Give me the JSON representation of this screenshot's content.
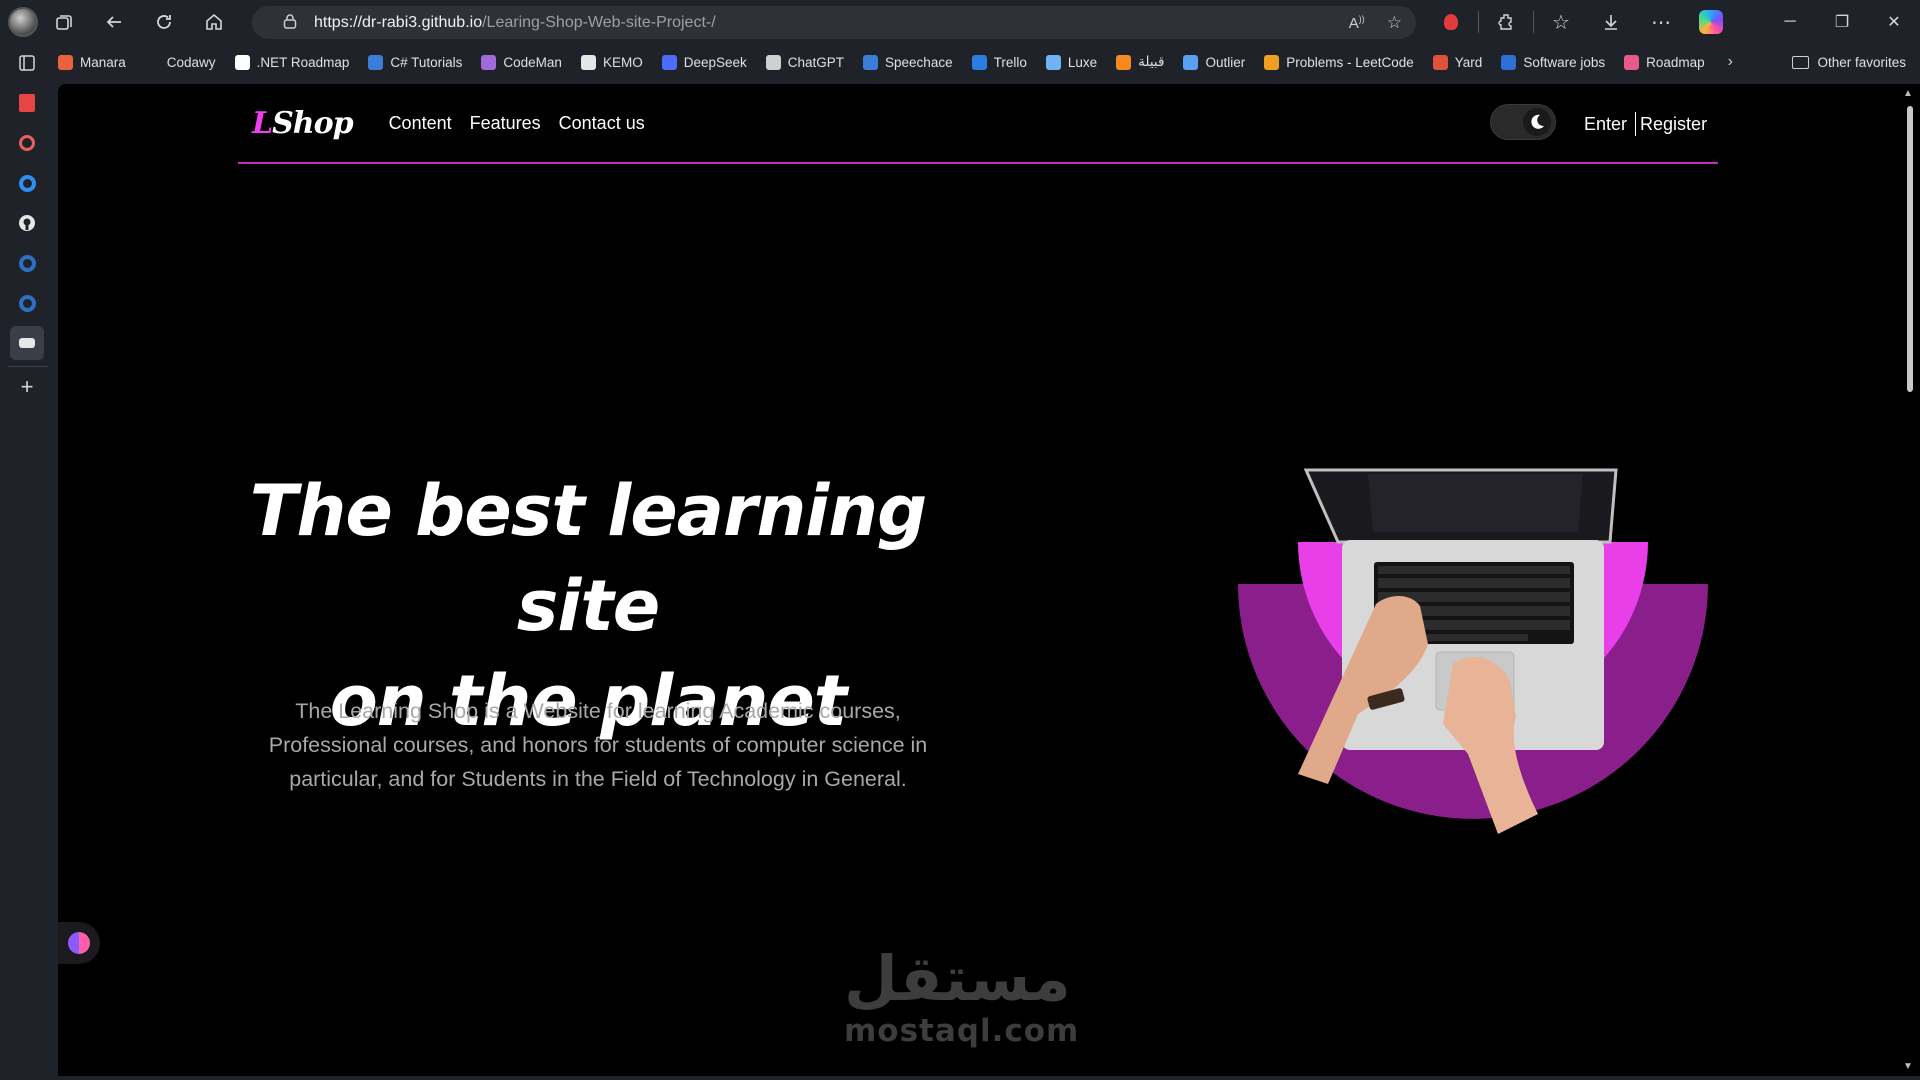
{
  "browser": {
    "url_host": "https://dr-rabi3.github.io",
    "url_path": "/Learing-Shop-Web-site-Project-/",
    "bookmarks": [
      {
        "label": "Manara",
        "color": "#e8623a"
      },
      {
        "label": "Codawy",
        "color": "#1f2228"
      },
      {
        "label": ".NET Roadmap",
        "color": "#ffffff"
      },
      {
        "label": "C# Tutorials",
        "color": "#3b7dd8"
      },
      {
        "label": "CodeMan",
        "color": "#a06ad8"
      },
      {
        "label": "KEMO",
        "color": "#e6e6e6"
      },
      {
        "label": "DeepSeek",
        "color": "#4d6bfe"
      },
      {
        "label": "ChatGPT",
        "color": "#d0d0d0"
      },
      {
        "label": "Speechace",
        "color": "#3b7dd8"
      },
      {
        "label": "Trello",
        "color": "#2a7de1"
      },
      {
        "label": "Luxe",
        "color": "#6fb3f5"
      },
      {
        "label": "قبيلة",
        "color": "#f58a1f"
      },
      {
        "label": "Outlier",
        "color": "#5aa0f0"
      },
      {
        "label": "Problems - LeetCode",
        "color": "#f0a020"
      },
      {
        "label": "Yard",
        "color": "#e0533a"
      },
      {
        "label": "Software jobs",
        "color": "#2f6fd6"
      },
      {
        "label": "Roadmap",
        "color": "#e85a8a"
      }
    ],
    "other_favorites": "Other favorites"
  },
  "site": {
    "logo_letter": "L",
    "logo_text": "Shop",
    "nav": [
      {
        "label": "Content"
      },
      {
        "label": "Features"
      },
      {
        "label": "Contact us"
      }
    ],
    "enter_label": "Enter",
    "register_label": "Register",
    "hero_title_line1": "The best learning site",
    "hero_title_line2": "on the planet",
    "hero_description": "The Learning Shop is a Website for learning Academic courses, Professional courses, and honors for students of computer science in particular, and for Students in the Field of Technology in General.",
    "accent_color": "#f03ef0"
  },
  "watermark": {
    "arabic": "مستقل",
    "latin": "mostaql.com"
  }
}
